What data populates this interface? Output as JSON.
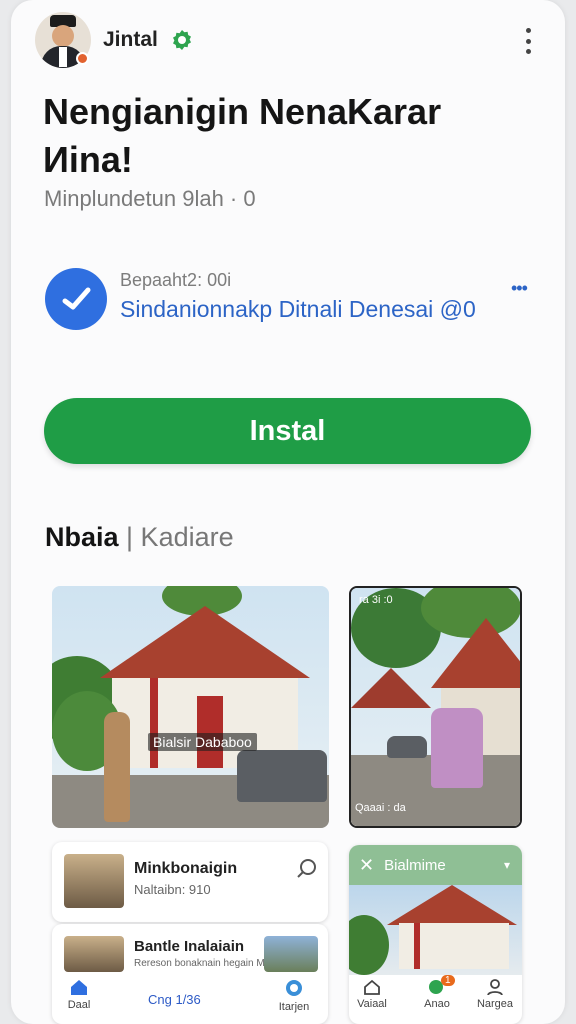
{
  "header": {
    "channel_name": "Jintal",
    "verified_color": "#2ea44f"
  },
  "app": {
    "title": "Nengianigin NenaKarar Иina!",
    "subtitle": "Minplundetun 9lah · 0"
  },
  "info": {
    "label": "Bepaaht2: 00i",
    "link": "Sindanionnakp Ditnali Denesai @0",
    "more": "•••"
  },
  "install": {
    "label": "Instal",
    "color": "#1f9d46"
  },
  "section": {
    "title_bold": "Nbaia",
    "title_light": "| Kadiare"
  },
  "screenshots": {
    "shot1_overlay": "Bialsir  Dababoo",
    "shot2_top": "ra 3i :0",
    "shot2_bottom": "Qaaai : da"
  },
  "list_cards": [
    {
      "title": "Minkbonaigin",
      "subtitle": "Naltaibn: 910"
    },
    {
      "title": "Bantle Inalaiain",
      "subtitle": "Rereson bonaknain hegain Mantanan",
      "footer": "Cng 1/36"
    }
  ],
  "promo": {
    "header": "Bialmime"
  },
  "bottom_nav_left": [
    {
      "icon": "home-icon",
      "label": "Daal"
    },
    {
      "icon": "globe-icon",
      "label": "Itarjen"
    }
  ],
  "bottom_nav_right": [
    {
      "icon": "home-icon",
      "label": "Vaiaal"
    },
    {
      "icon": "apps-icon",
      "label": "Anao",
      "badge": "1"
    },
    {
      "icon": "user-icon",
      "label": "Nargea"
    }
  ]
}
